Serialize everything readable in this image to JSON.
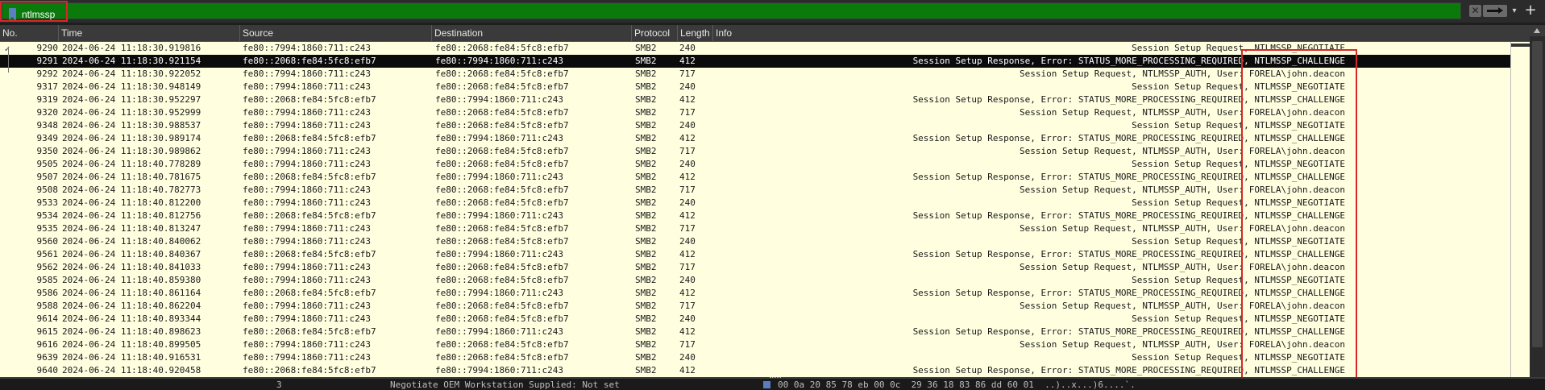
{
  "filter": {
    "value": "ntlmssp",
    "clear_icon": "clear-x-icon",
    "apply_icon": "arrow-right-icon",
    "dropdown_icon": "chevron-down-icon",
    "add_icon": "plus-icon"
  },
  "columns": {
    "no": "No.",
    "time": "Time",
    "source": "Source",
    "destination": "Destination",
    "protocol": "Protocol",
    "length": "Length",
    "info": "Info"
  },
  "colors": {
    "filter_valid": "#0a7a0a",
    "row_bg": "#ffffe0",
    "selected_bg": "#0b0b0b",
    "highlight": "#d62828"
  },
  "packets": [
    {
      "no": "9290",
      "time": "2024-06-24 11:18:30.919816",
      "src": "fe80::7994:1860:711:c243",
      "dst": "fe80::2068:fe84:5fc8:efb7",
      "proto": "SMB2",
      "len": "240",
      "info": "Session Setup Request, NTLMSSP_NEGOTIATE"
    },
    {
      "no": "9291",
      "time": "2024-06-24 11:18:30.921154",
      "src": "fe80::2068:fe84:5fc8:efb7",
      "dst": "fe80::7994:1860:711:c243",
      "proto": "SMB2",
      "len": "412",
      "info": "Session Setup Response, Error: STATUS_MORE_PROCESSING_REQUIRED, NTLMSSP_CHALLENGE",
      "selected": true
    },
    {
      "no": "9292",
      "time": "2024-06-24 11:18:30.922052",
      "src": "fe80::7994:1860:711:c243",
      "dst": "fe80::2068:fe84:5fc8:efb7",
      "proto": "SMB2",
      "len": "717",
      "info": "Session Setup Request, NTLMSSP_AUTH, User: FORELA\\john.deacon"
    },
    {
      "no": "9317",
      "time": "2024-06-24 11:18:30.948149",
      "src": "fe80::7994:1860:711:c243",
      "dst": "fe80::2068:fe84:5fc8:efb7",
      "proto": "SMB2",
      "len": "240",
      "info": "Session Setup Request, NTLMSSP_NEGOTIATE"
    },
    {
      "no": "9319",
      "time": "2024-06-24 11:18:30.952297",
      "src": "fe80::2068:fe84:5fc8:efb7",
      "dst": "fe80::7994:1860:711:c243",
      "proto": "SMB2",
      "len": "412",
      "info": "Session Setup Response, Error: STATUS_MORE_PROCESSING_REQUIRED, NTLMSSP_CHALLENGE"
    },
    {
      "no": "9320",
      "time": "2024-06-24 11:18:30.952999",
      "src": "fe80::7994:1860:711:c243",
      "dst": "fe80::2068:fe84:5fc8:efb7",
      "proto": "SMB2",
      "len": "717",
      "info": "Session Setup Request, NTLMSSP_AUTH, User: FORELA\\john.deacon"
    },
    {
      "no": "9348",
      "time": "2024-06-24 11:18:30.988537",
      "src": "fe80::7994:1860:711:c243",
      "dst": "fe80::2068:fe84:5fc8:efb7",
      "proto": "SMB2",
      "len": "240",
      "info": "Session Setup Request, NTLMSSP_NEGOTIATE"
    },
    {
      "no": "9349",
      "time": "2024-06-24 11:18:30.989174",
      "src": "fe80::2068:fe84:5fc8:efb7",
      "dst": "fe80::7994:1860:711:c243",
      "proto": "SMB2",
      "len": "412",
      "info": "Session Setup Response, Error: STATUS_MORE_PROCESSING_REQUIRED, NTLMSSP_CHALLENGE"
    },
    {
      "no": "9350",
      "time": "2024-06-24 11:18:30.989862",
      "src": "fe80::7994:1860:711:c243",
      "dst": "fe80::2068:fe84:5fc8:efb7",
      "proto": "SMB2",
      "len": "717",
      "info": "Session Setup Request, NTLMSSP_AUTH, User: FORELA\\john.deacon"
    },
    {
      "no": "9505",
      "time": "2024-06-24 11:18:40.778289",
      "src": "fe80::7994:1860:711:c243",
      "dst": "fe80::2068:fe84:5fc8:efb7",
      "proto": "SMB2",
      "len": "240",
      "info": "Session Setup Request, NTLMSSP_NEGOTIATE"
    },
    {
      "no": "9507",
      "time": "2024-06-24 11:18:40.781675",
      "src": "fe80::2068:fe84:5fc8:efb7",
      "dst": "fe80::7994:1860:711:c243",
      "proto": "SMB2",
      "len": "412",
      "info": "Session Setup Response, Error: STATUS_MORE_PROCESSING_REQUIRED, NTLMSSP_CHALLENGE"
    },
    {
      "no": "9508",
      "time": "2024-06-24 11:18:40.782773",
      "src": "fe80::7994:1860:711:c243",
      "dst": "fe80::2068:fe84:5fc8:efb7",
      "proto": "SMB2",
      "len": "717",
      "info": "Session Setup Request, NTLMSSP_AUTH, User: FORELA\\john.deacon"
    },
    {
      "no": "9533",
      "time": "2024-06-24 11:18:40.812200",
      "src": "fe80::7994:1860:711:c243",
      "dst": "fe80::2068:fe84:5fc8:efb7",
      "proto": "SMB2",
      "len": "240",
      "info": "Session Setup Request, NTLMSSP_NEGOTIATE"
    },
    {
      "no": "9534",
      "time": "2024-06-24 11:18:40.812756",
      "src": "fe80::2068:fe84:5fc8:efb7",
      "dst": "fe80::7994:1860:711:c243",
      "proto": "SMB2",
      "len": "412",
      "info": "Session Setup Response, Error: STATUS_MORE_PROCESSING_REQUIRED, NTLMSSP_CHALLENGE"
    },
    {
      "no": "9535",
      "time": "2024-06-24 11:18:40.813247",
      "src": "fe80::7994:1860:711:c243",
      "dst": "fe80::2068:fe84:5fc8:efb7",
      "proto": "SMB2",
      "len": "717",
      "info": "Session Setup Request, NTLMSSP_AUTH, User: FORELA\\john.deacon"
    },
    {
      "no": "9560",
      "time": "2024-06-24 11:18:40.840062",
      "src": "fe80::7994:1860:711:c243",
      "dst": "fe80::2068:fe84:5fc8:efb7",
      "proto": "SMB2",
      "len": "240",
      "info": "Session Setup Request, NTLMSSP_NEGOTIATE"
    },
    {
      "no": "9561",
      "time": "2024-06-24 11:18:40.840367",
      "src": "fe80::2068:fe84:5fc8:efb7",
      "dst": "fe80::7994:1860:711:c243",
      "proto": "SMB2",
      "len": "412",
      "info": "Session Setup Response, Error: STATUS_MORE_PROCESSING_REQUIRED, NTLMSSP_CHALLENGE"
    },
    {
      "no": "9562",
      "time": "2024-06-24 11:18:40.841033",
      "src": "fe80::7994:1860:711:c243",
      "dst": "fe80::2068:fe84:5fc8:efb7",
      "proto": "SMB2",
      "len": "717",
      "info": "Session Setup Request, NTLMSSP_AUTH, User: FORELA\\john.deacon"
    },
    {
      "no": "9585",
      "time": "2024-06-24 11:18:40.859380",
      "src": "fe80::7994:1860:711:c243",
      "dst": "fe80::2068:fe84:5fc8:efb7",
      "proto": "SMB2",
      "len": "240",
      "info": "Session Setup Request, NTLMSSP_NEGOTIATE"
    },
    {
      "no": "9586",
      "time": "2024-06-24 11:18:40.861164",
      "src": "fe80::2068:fe84:5fc8:efb7",
      "dst": "fe80::7994:1860:711:c243",
      "proto": "SMB2",
      "len": "412",
      "info": "Session Setup Response, Error: STATUS_MORE_PROCESSING_REQUIRED, NTLMSSP_CHALLENGE"
    },
    {
      "no": "9588",
      "time": "2024-06-24 11:18:40.862204",
      "src": "fe80::7994:1860:711:c243",
      "dst": "fe80::2068:fe84:5fc8:efb7",
      "proto": "SMB2",
      "len": "717",
      "info": "Session Setup Request, NTLMSSP_AUTH, User: FORELA\\john.deacon"
    },
    {
      "no": "9614",
      "time": "2024-06-24 11:18:40.893344",
      "src": "fe80::7994:1860:711:c243",
      "dst": "fe80::2068:fe84:5fc8:efb7",
      "proto": "SMB2",
      "len": "240",
      "info": "Session Setup Request, NTLMSSP_NEGOTIATE"
    },
    {
      "no": "9615",
      "time": "2024-06-24 11:18:40.898623",
      "src": "fe80::2068:fe84:5fc8:efb7",
      "dst": "fe80::7994:1860:711:c243",
      "proto": "SMB2",
      "len": "412",
      "info": "Session Setup Response, Error: STATUS_MORE_PROCESSING_REQUIRED, NTLMSSP_CHALLENGE"
    },
    {
      "no": "9616",
      "time": "2024-06-24 11:18:40.899505",
      "src": "fe80::7994:1860:711:c243",
      "dst": "fe80::2068:fe84:5fc8:efb7",
      "proto": "SMB2",
      "len": "717",
      "info": "Session Setup Request, NTLMSSP_AUTH, User: FORELA\\john.deacon"
    },
    {
      "no": "9639",
      "time": "2024-06-24 11:18:40.916531",
      "src": "fe80::7994:1860:711:c243",
      "dst": "fe80::2068:fe84:5fc8:efb7",
      "proto": "SMB2",
      "len": "240",
      "info": "Session Setup Request, NTLMSSP_NEGOTIATE"
    },
    {
      "no": "9640",
      "time": "2024-06-24 11:18:40.920458",
      "src": "fe80::2068:fe84:5fc8:efb7",
      "dst": "fe80::7994:1860:711:c243",
      "proto": "SMB2",
      "len": "412",
      "info": "Session Setup Response, Error: STATUS_MORE_PROCESSING_REQUIRED, NTLMSSP_CHALLENGE"
    }
  ],
  "bottom_pane": {
    "left_value": "3",
    "middle_text": "Negotiate OEM Workstation Supplied: Not set",
    "right_text": "00 0a 20 85 78 eb 00 0c  29 36 18 83 86 dd 60 01  ..)..x...)6....`."
  }
}
